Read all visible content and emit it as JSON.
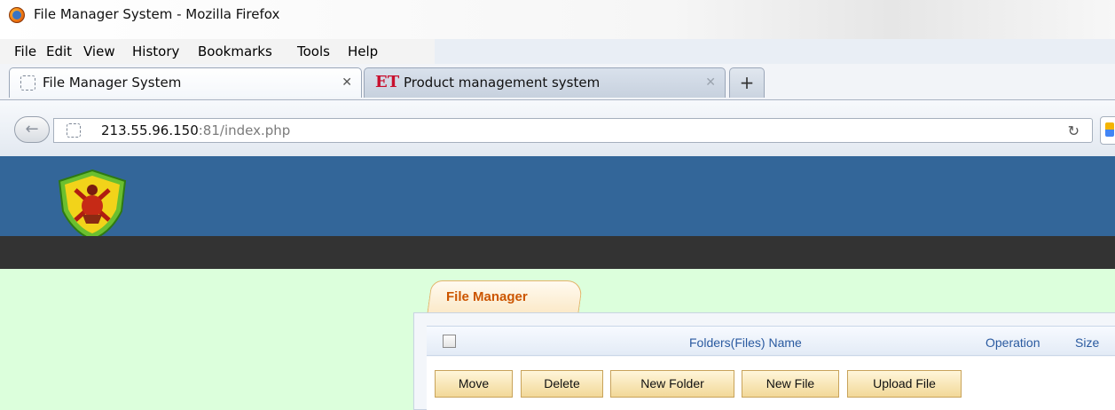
{
  "window": {
    "title": "File Manager System - Mozilla Firefox"
  },
  "menu": [
    "File",
    "Edit",
    "View",
    "History",
    "Bookmarks",
    "Tools",
    "Help"
  ],
  "tabs": [
    {
      "label": "File Manager System",
      "active": true
    },
    {
      "label": "Product management system",
      "favicon_text": "ET",
      "active": false
    }
  ],
  "address": {
    "host": "213.55.96.150",
    "rest": ":81/index.php"
  },
  "colors": {
    "header": "#336699",
    "navbar": "#333333",
    "content_bg": "#dcffdc",
    "tab_label": "#cc5500"
  },
  "file_manager": {
    "tab_label": "File Manager",
    "columns": {
      "name": "Folders(Files) Name",
      "operation": "Operation",
      "size": "Size"
    },
    "buttons": [
      "Move",
      "Delete",
      "New Folder",
      "New File",
      "Upload File"
    ]
  }
}
